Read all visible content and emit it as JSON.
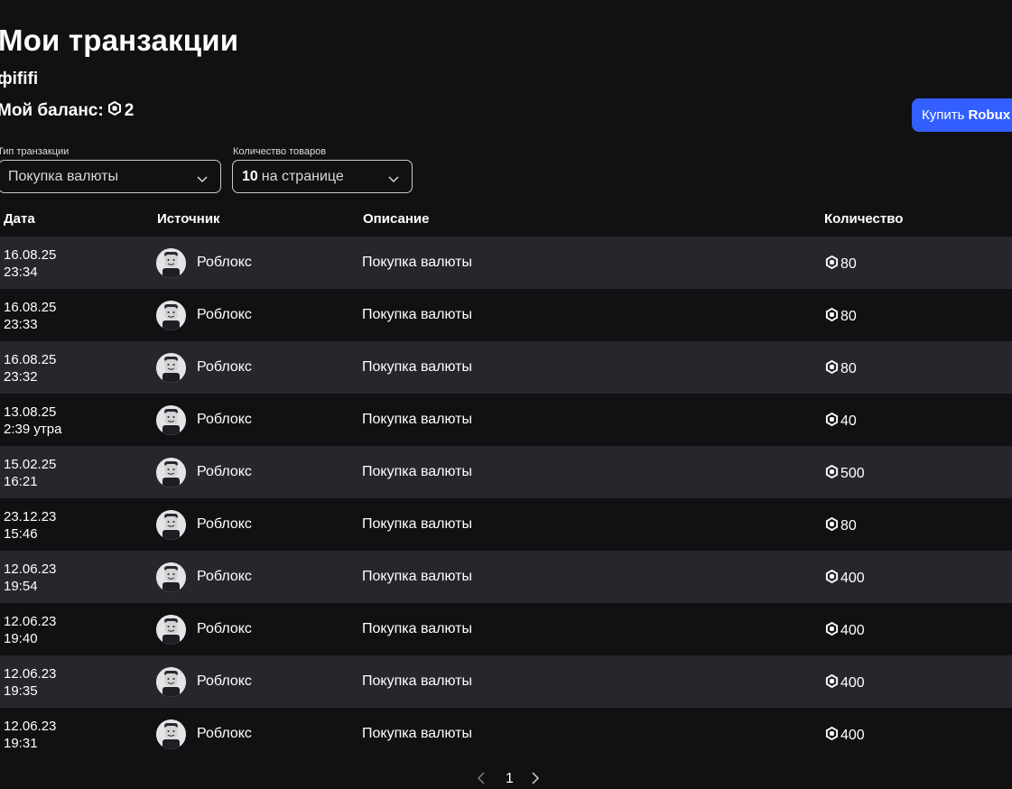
{
  "page": {
    "title": "Мои транзакции",
    "username": "фififi",
    "balance_label": "Мой баланс:",
    "balance_value": "2",
    "buy_button_prefix": "Купить",
    "buy_button_bold": "Robux"
  },
  "filters": {
    "type_label": "Тип транзакции",
    "type_value": "Покупка валюты",
    "count_label": "Количество товаров",
    "count_number": "10",
    "count_suffix": "на странице"
  },
  "table": {
    "columns": [
      "Дата",
      "Источник",
      "Описание",
      "Количество"
    ],
    "rows": [
      {
        "date": "16.08.25",
        "time": "23:34",
        "source": "Роблокс",
        "description": "Покупка валюты",
        "amount": "80"
      },
      {
        "date": "16.08.25",
        "time": "23:33",
        "source": "Роблокс",
        "description": "Покупка валюты",
        "amount": "80"
      },
      {
        "date": "16.08.25",
        "time": "23:32",
        "source": "Роблокс",
        "description": "Покупка валюты",
        "amount": "80"
      },
      {
        "date": "13.08.25",
        "time": "2:39 утра",
        "source": "Роблокс",
        "description": "Покупка валюты",
        "amount": "40"
      },
      {
        "date": "15.02.25",
        "time": "16:21",
        "source": "Роблокс",
        "description": "Покупка валюты",
        "amount": "500"
      },
      {
        "date": "23.12.23",
        "time": "15:46",
        "source": "Роблокс",
        "description": "Покупка валюты",
        "amount": "80"
      },
      {
        "date": "12.06.23",
        "time": "19:54",
        "source": "Роблокс",
        "description": "Покупка валюты",
        "amount": "400"
      },
      {
        "date": "12.06.23",
        "time": "19:40",
        "source": "Роблокс",
        "description": "Покупка валюты",
        "amount": "400"
      },
      {
        "date": "12.06.23",
        "time": "19:35",
        "source": "Роблокс",
        "description": "Покупка валюты",
        "amount": "400"
      },
      {
        "date": "12.06.23",
        "time": "19:31",
        "source": "Роблокс",
        "description": "Покупка валюты",
        "amount": "400"
      }
    ]
  },
  "pagination": {
    "current_page": "1"
  },
  "icons": {
    "currency": "robux-icon",
    "select_arrow": "chevron-down-icon",
    "prev": "chevron-left-icon",
    "next": "chevron-right-icon",
    "avatar": "avatar-icon"
  },
  "colors": {
    "background": "#111113",
    "row_alt": "#25272c",
    "accent": "#335fff",
    "text": "#ffffff"
  }
}
